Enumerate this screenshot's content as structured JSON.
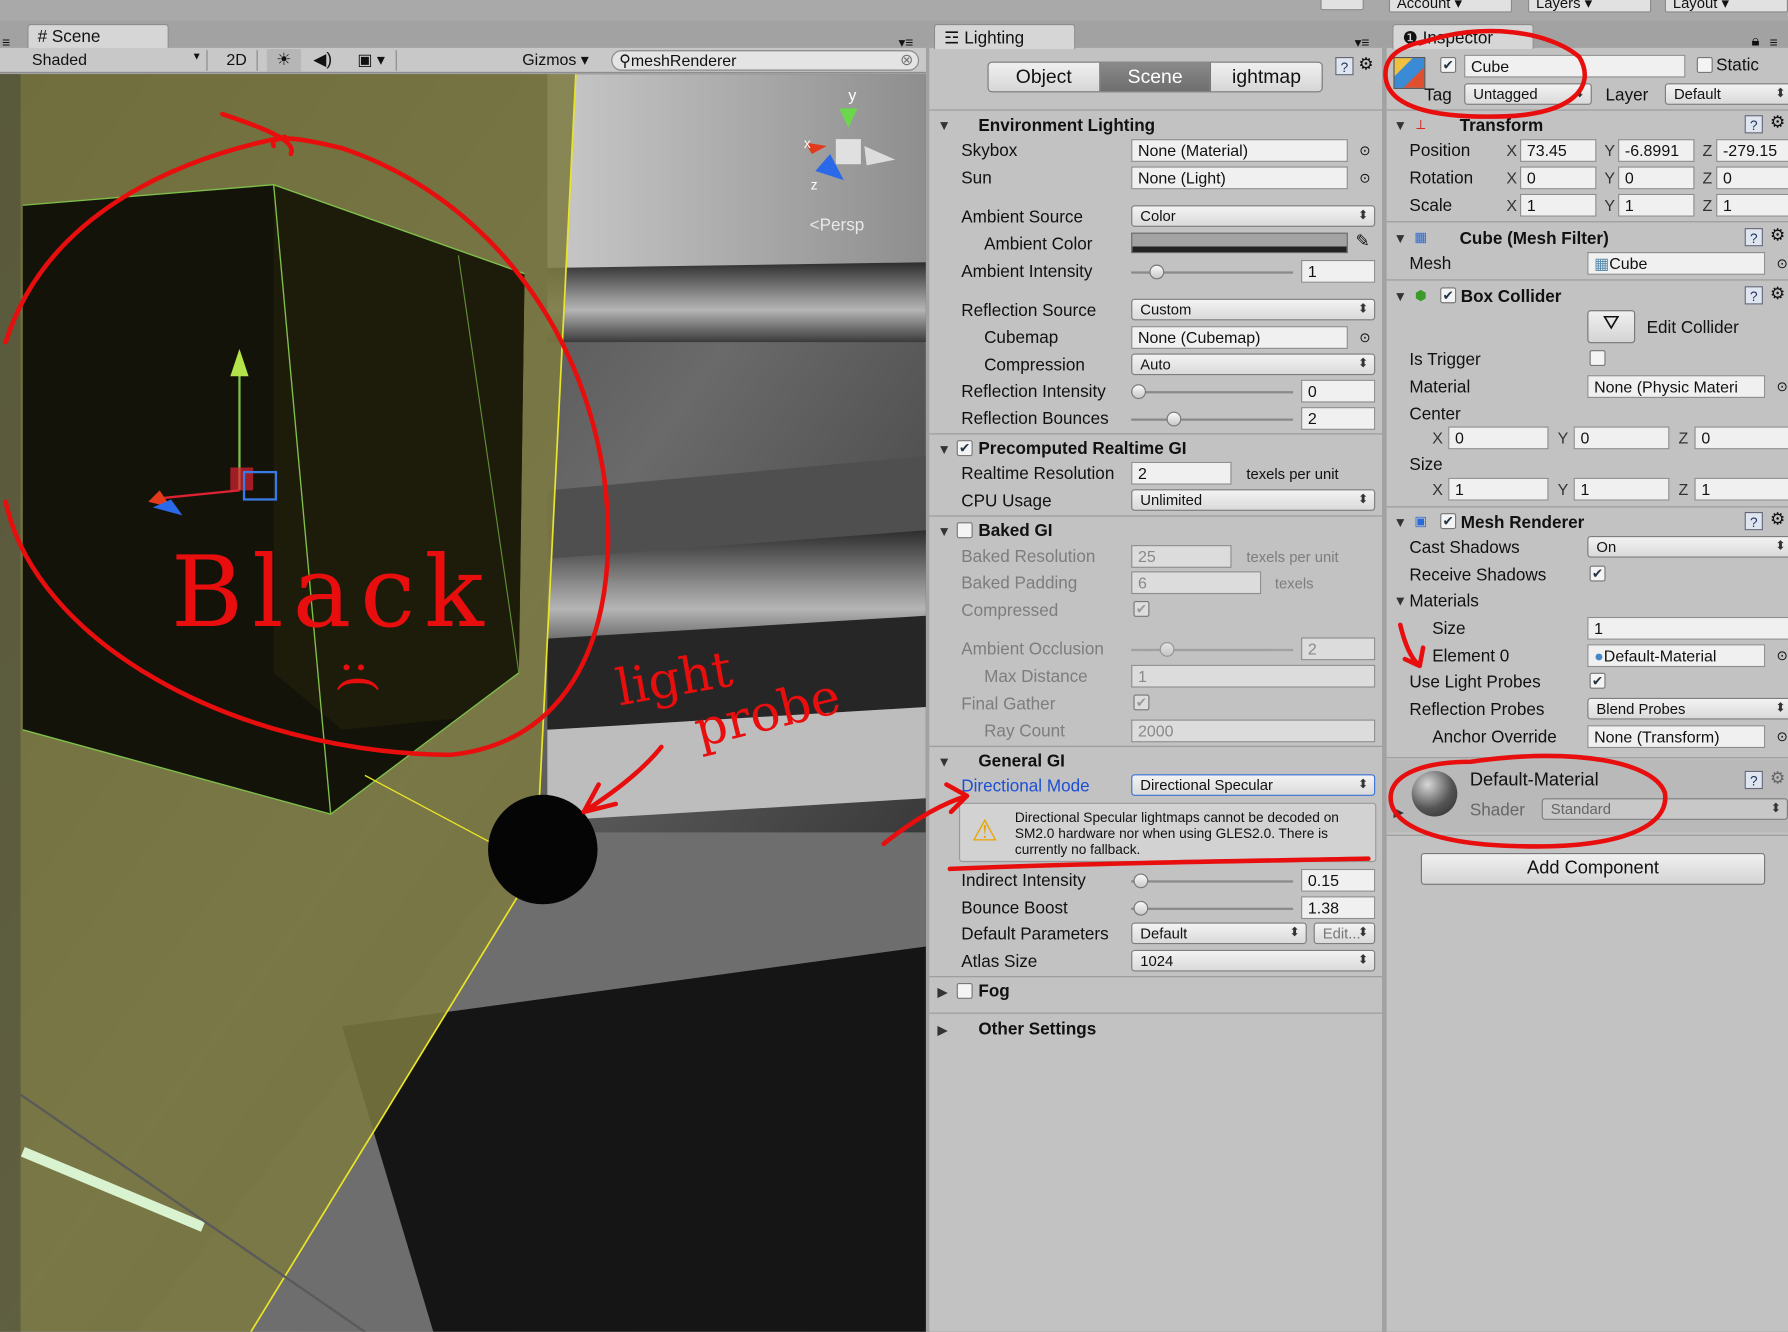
{
  "top_right": {
    "account": "Account",
    "layers": "Layers",
    "layout": "Layout"
  },
  "scene": {
    "tab": "Scene",
    "shading": "Shaded",
    "mode_2d": "2D",
    "gizmos": "Gizmos",
    "search_value": "meshRenderer",
    "persp": "Persp"
  },
  "lighting": {
    "tab": "Lighting",
    "tabs": {
      "object": "Object",
      "scene": "Scene",
      "lightmap": "ightmap"
    },
    "env": {
      "header": "Environment Lighting",
      "skybox": "Skybox",
      "skybox_val": "None (Material)",
      "sun": "Sun",
      "sun_val": "None (Light)",
      "ambient_source": "Ambient Source",
      "ambient_source_val": "Color",
      "ambient_color": "Ambient Color",
      "ambient_intensity": "Ambient Intensity",
      "ambient_intensity_val": "1",
      "refl_source": "Reflection Source",
      "refl_source_val": "Custom",
      "cubemap": "Cubemap",
      "cubemap_val": "None (Cubemap)",
      "compression": "Compression",
      "compression_val": "Auto",
      "refl_intensity": "Reflection Intensity",
      "refl_intensity_val": "0",
      "refl_bounces": "Reflection Bounces",
      "refl_bounces_val": "2"
    },
    "realtime": {
      "header": "Precomputed Realtime GI",
      "res": "Realtime Resolution",
      "res_val": "2",
      "unit": "texels per unit",
      "cpu": "CPU Usage",
      "cpu_val": "Unlimited"
    },
    "baked": {
      "header": "Baked GI",
      "res": "Baked Resolution",
      "res_val": "25",
      "res_unit": "texels per unit",
      "pad": "Baked Padding",
      "pad_val": "6",
      "pad_unit": "texels",
      "compressed": "Compressed",
      "ao": "Ambient Occlusion",
      "ao_val": "2",
      "maxd": "Max Distance",
      "maxd_val": "1",
      "fg": "Final Gather",
      "ray": "Ray Count",
      "ray_val": "2000"
    },
    "general": {
      "header": "General GI",
      "dir_mode": "Directional Mode",
      "dir_mode_val": "Directional Specular",
      "warning": "Directional Specular lightmaps cannot be decoded on SM2.0 hardware nor when using GLES2.0. There is currently no fallback.",
      "indirect": "Indirect Intensity",
      "indirect_val": "0.15",
      "bounce": "Bounce Boost",
      "bounce_val": "1.38",
      "defparams": "Default Parameters",
      "defparams_val": "Default",
      "edit": "Edit...",
      "atlas": "Atlas Size",
      "atlas_val": "1024"
    },
    "fog": "Fog",
    "other": "Other Settings"
  },
  "inspector": {
    "tab": "Inspector",
    "name": "Cube",
    "static": "Static",
    "tag": "Tag",
    "tag_val": "Untagged",
    "layer": "Layer",
    "layer_val": "Default",
    "transform": {
      "header": "Transform",
      "position": "Position",
      "rotation": "Rotation",
      "scale": "Scale",
      "pos": [
        "73.45",
        "-6.8991",
        "-279.15"
      ],
      "rot": [
        "0",
        "0",
        "0"
      ],
      "scl": [
        "1",
        "1",
        "1"
      ]
    },
    "meshfilter": {
      "header": "Cube (Mesh Filter)",
      "mesh": "Mesh",
      "mesh_val": "Cube"
    },
    "collider": {
      "header": "Box Collider",
      "edit": "Edit Collider",
      "trigger": "Is Trigger",
      "material": "Material",
      "material_val": "None (Physic Materi",
      "center": "Center",
      "center_vals": [
        "0",
        "0",
        "0"
      ],
      "size": "Size",
      "size_vals": [
        "1",
        "1",
        "1"
      ]
    },
    "renderer": {
      "header": "Mesh Renderer",
      "cast": "Cast Shadows",
      "cast_val": "On",
      "receive": "Receive Shadows",
      "materials": "Materials",
      "size": "Size",
      "size_val": "1",
      "element": "Element 0",
      "element_val": "Default-Material",
      "probes": "Use Light Probes",
      "refl": "Reflection Probes",
      "refl_val": "Blend Probes",
      "anchor": "Anchor Override",
      "anchor_val": "None (Transform)"
    },
    "material": {
      "name": "Default-Material",
      "shader": "Shader",
      "shader_val": "Standard"
    },
    "add": "Add Component"
  },
  "axes": {
    "x": "X",
    "y": "Y",
    "z": "Z"
  },
  "annotations": {
    "black": "Black",
    "frown": ":(",
    "light": "light",
    "probe": "probe"
  },
  "colors": {
    "ink": "#e80e0e",
    "selection": "#d6d35a"
  }
}
